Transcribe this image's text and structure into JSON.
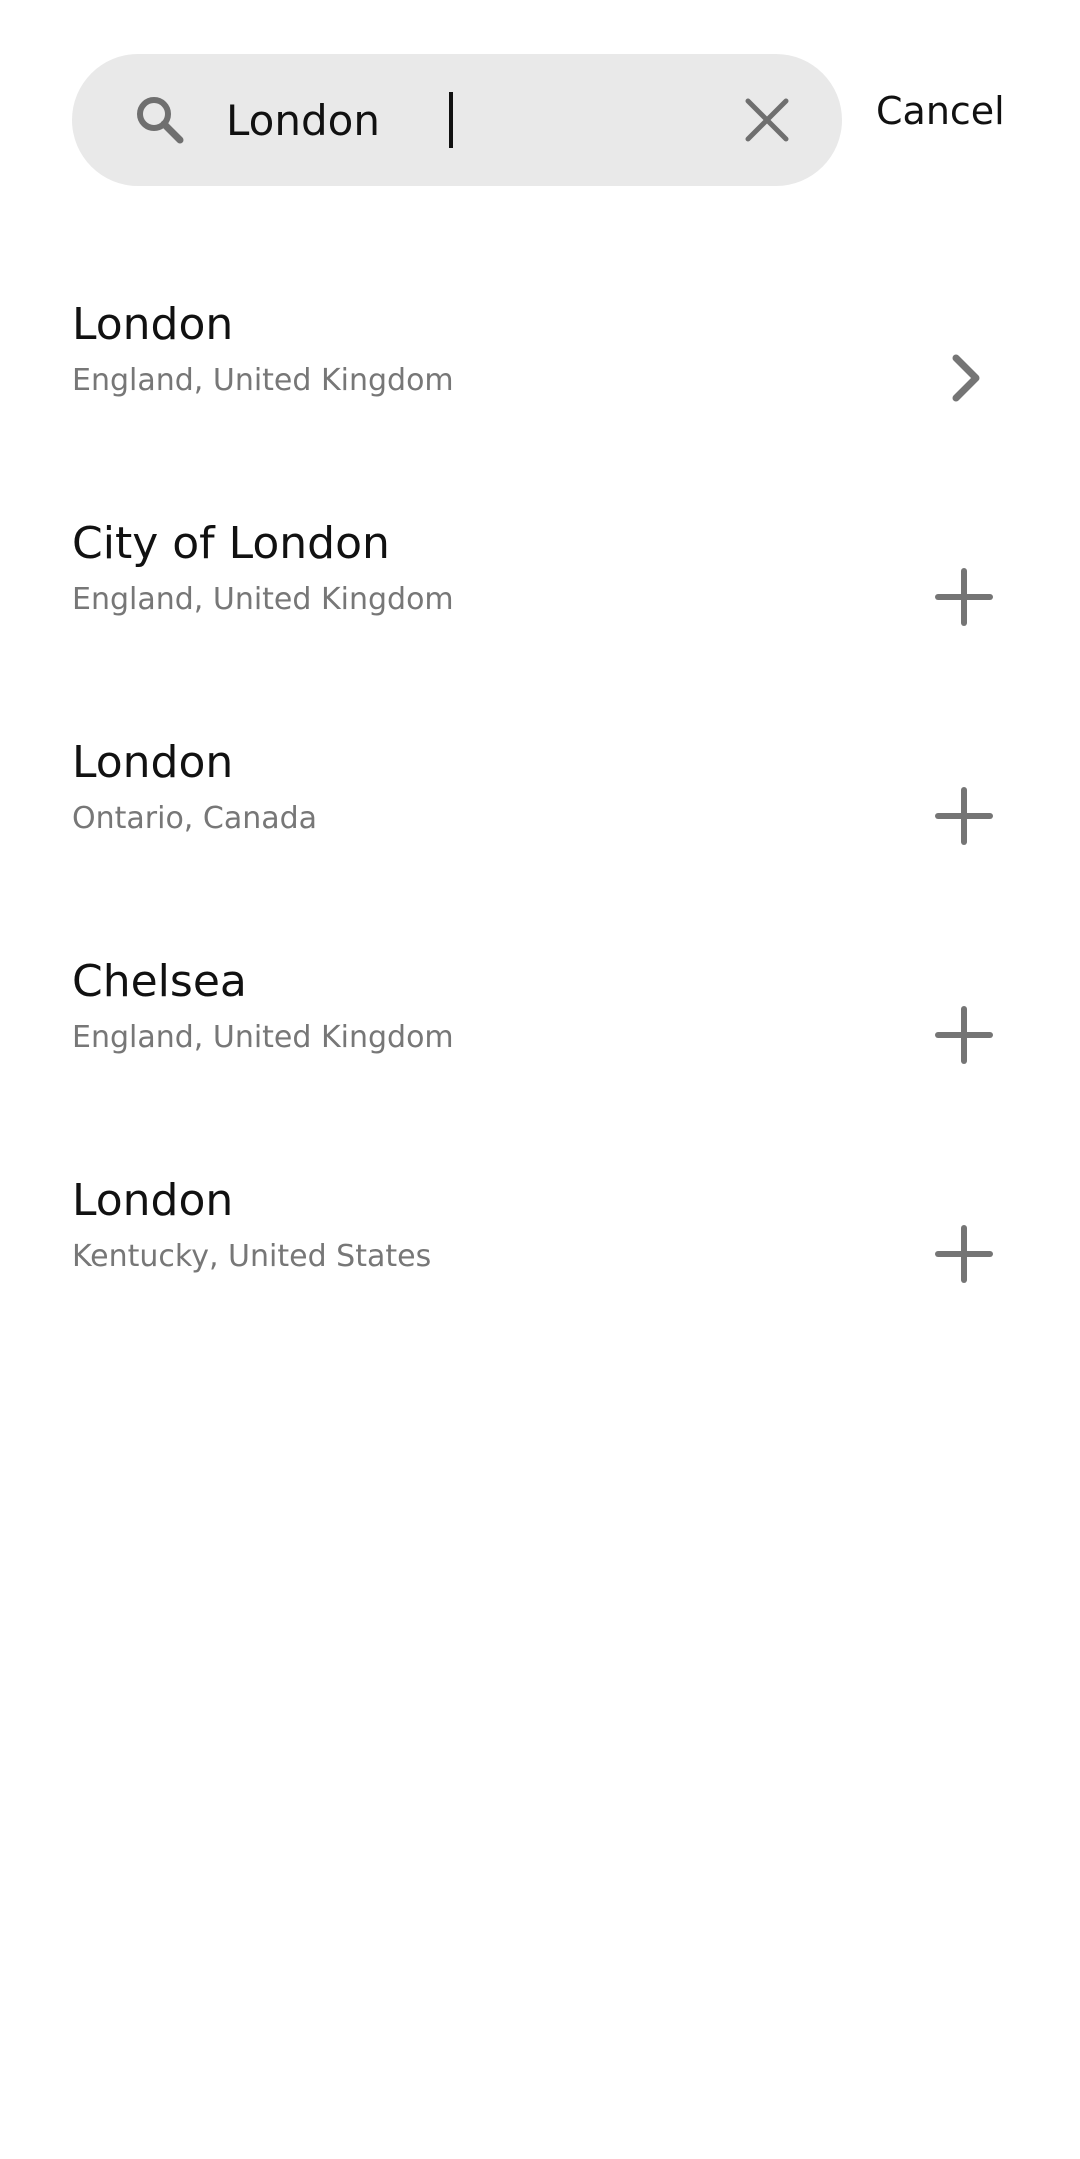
{
  "search": {
    "value": "London",
    "placeholder": "",
    "cancel_label": "Cancel",
    "search_icon": "search-icon",
    "clear_icon": "close-icon"
  },
  "results": [
    {
      "title": "London",
      "subtitle": "England, United Kingdom",
      "action_icon": "chevron-right-icon"
    },
    {
      "title": "City of London",
      "subtitle": "England, United Kingdom",
      "action_icon": "plus-icon"
    },
    {
      "title": "London",
      "subtitle": "Ontario, Canada",
      "action_icon": "plus-icon"
    },
    {
      "title": "Chelsea",
      "subtitle": "England, United Kingdom",
      "action_icon": "plus-icon"
    },
    {
      "title": "London",
      "subtitle": "Kentucky, United States",
      "action_icon": "plus-icon"
    }
  ],
  "colors": {
    "search_bg": "#e9e9e9",
    "icon_gray": "#757575",
    "subtitle_gray": "#777777",
    "text": "#111111"
  }
}
